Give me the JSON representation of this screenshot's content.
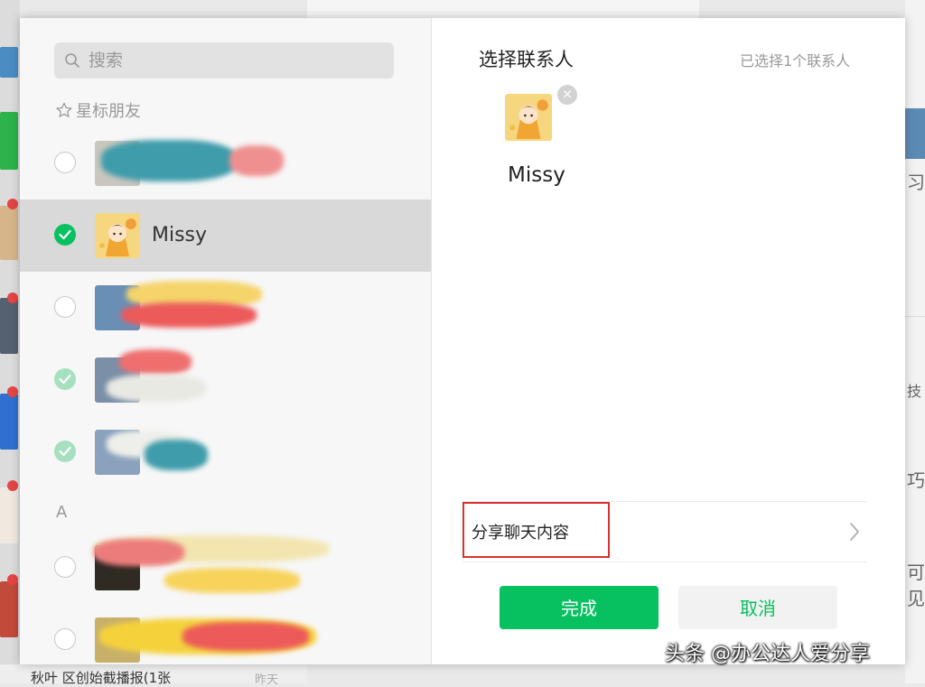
{
  "background": {
    "right_chars": [
      "习",
      "技",
      "巧",
      "可见"
    ],
    "bottom_text": "秋叶 区创始截播报(1张",
    "bottom_time": "昨天"
  },
  "search": {
    "placeholder": "搜索"
  },
  "left_panel": {
    "starred_header": "星标朋友",
    "section_a": "A",
    "contacts": [
      {
        "name": "",
        "state": "unchecked"
      },
      {
        "name": "Missy",
        "state": "checked"
      },
      {
        "name": "",
        "state": "unchecked"
      },
      {
        "name": "",
        "state": "checked-disabled"
      },
      {
        "name": "",
        "state": "checked-disabled"
      },
      {
        "name": "",
        "state": "unchecked"
      },
      {
        "name": "",
        "state": "unchecked"
      }
    ]
  },
  "right_panel": {
    "title": "选择联系人",
    "selected_count": "已选择1个联系人",
    "selected_contact_name": "Missy",
    "remove_symbol": "×",
    "share_label": "分享聊天内容"
  },
  "buttons": {
    "done": "完成",
    "cancel": "取消"
  },
  "watermark": "头条 @办公达人爱分享",
  "colors": {
    "accent": "#07c160",
    "highlight": "#d9302e"
  }
}
